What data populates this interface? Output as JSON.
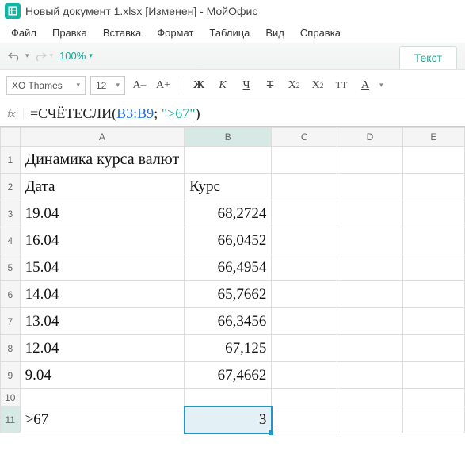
{
  "window": {
    "title": "Новый документ 1.xlsx [Изменен] - МойОфис"
  },
  "menu": {
    "file": "Файл",
    "edit": "Правка",
    "insert": "Вставка",
    "format": "Формат",
    "table": "Таблица",
    "view": "Вид",
    "help": "Справка"
  },
  "tb1": {
    "zoom": "100%",
    "context_tab": "Текст"
  },
  "tb2": {
    "font": "XO Thames",
    "size": "12",
    "dec": "A–",
    "inc": "A+",
    "bold": "Ж",
    "italic": "К",
    "under": "Ч",
    "strike": "Т",
    "sup": "X",
    "sup2": "2",
    "sub": "X",
    "sub2": "2",
    "caps": "ТТ",
    "fcolor": "А"
  },
  "formula": {
    "fx": "fx",
    "eq": "=",
    "fn": "СЧЁТЕСЛИ",
    "open": "(",
    "ref": "B3:B9",
    "sep": "; ",
    "str": "\">67\"",
    "close": ")"
  },
  "cols": {
    "A": "A",
    "B": "B",
    "C": "C",
    "D": "D",
    "E": "E"
  },
  "rows": {
    "r1": "1",
    "r2": "2",
    "r3": "3",
    "r4": "4",
    "r5": "5",
    "r6": "6",
    "r7": "7",
    "r8": "8",
    "r9": "9",
    "r10": "10",
    "r11": "11"
  },
  "sheet": {
    "a1": "Динамика курса валют",
    "a2": "Дата",
    "b2": "Курс",
    "a3": "19.04",
    "b3": "68,2724",
    "a4": "16.04",
    "b4": "66,0452",
    "a5": "15.04",
    "b5": "66,4954",
    "a6": "14.04",
    "b6": "65,7662",
    "a7": "13.04",
    "b7": "66,3456",
    "a8": "12.04",
    "b8": "67,125",
    "a9": "9.04",
    "b9": "67,4662",
    "a11": ">67",
    "b11": "3"
  }
}
